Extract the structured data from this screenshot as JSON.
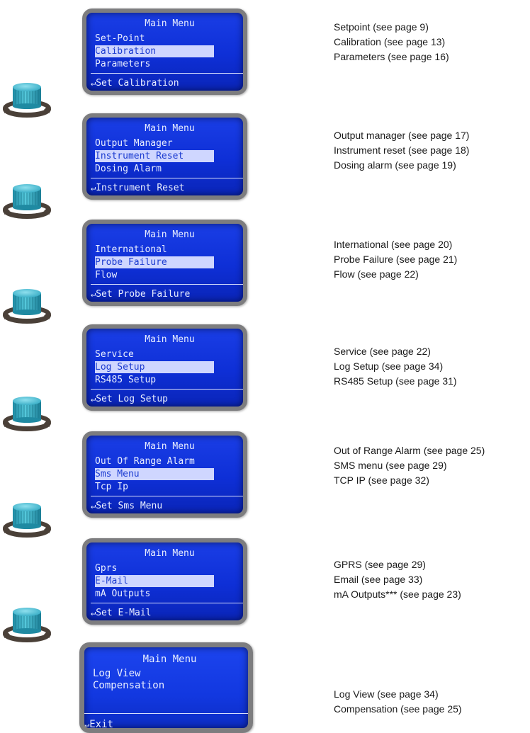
{
  "menus": [
    {
      "title": "Main Menu",
      "items": [
        "Set-Point",
        "Calibration",
        "Parameters"
      ],
      "selected": 1,
      "footer": "Set Calibration",
      "descriptions": [
        "Setpoint (see page 9)",
        "Calibration (see page 13)",
        "Parameters (see page 16)"
      ]
    },
    {
      "title": "Main Menu",
      "items": [
        "Output Manager",
        "Instrument Reset",
        "Dosing Alarm"
      ],
      "selected": 1,
      "footer": "Instrument Reset",
      "descriptions": [
        "Output manager (see page 17)",
        "Instrument reset (see page 18)",
        "Dosing alarm (see page 19)"
      ]
    },
    {
      "title": "Main Menu",
      "items": [
        "International",
        "Probe Failure",
        "Flow"
      ],
      "selected": 1,
      "footer": "Set Probe Failure",
      "descriptions": [
        "International (see page 20)",
        "Probe Failure (see page 21)",
        "Flow (see page 22)"
      ]
    },
    {
      "title": "Main Menu",
      "items": [
        "Service",
        "Log Setup",
        "RS485 Setup"
      ],
      "selected": 1,
      "footer": "Set Log Setup",
      "descriptions": [
        "Service (see page 22)",
        "Log Setup (see page 34)",
        "RS485 Setup (see page 31)"
      ]
    },
    {
      "title": "Main Menu",
      "items": [
        "Out Of Range Alarm",
        "Sms Menu",
        "Tcp Ip"
      ],
      "selected": 1,
      "footer": "Set Sms Menu",
      "descriptions": [
        "Out of Range Alarm (see page 25)",
        "SMS menu (see page  29)",
        "TCP IP (see page 32)"
      ]
    },
    {
      "title": "Main Menu",
      "items": [
        "Gprs",
        "E-Mail",
        "mA Outputs"
      ],
      "selected": 1,
      "footer": "Set E-Mail",
      "descriptions": [
        "GPRS (see page 29)",
        "Email (see page 33)",
        "mA Outputs*** (see page 23)"
      ]
    },
    {
      "title": "Main Menu",
      "items": [
        "Log View",
        "Compensation"
      ],
      "selected": -1,
      "footer": "Exit",
      "descriptions": [
        "Log View (see page 34)",
        "Compensation (see page 25)"
      ]
    }
  ],
  "footer_arrow": "↵",
  "knob_icon": "rotary-knob-icon",
  "colors": {
    "lcd_background": "#1437e0",
    "lcd_text": "#e9eeff",
    "highlight_bg": "#cfd6ff",
    "bezel": "#7d7d7f",
    "knob_cap": "#3fb8cf",
    "knob_arrow": "#4a4038"
  }
}
